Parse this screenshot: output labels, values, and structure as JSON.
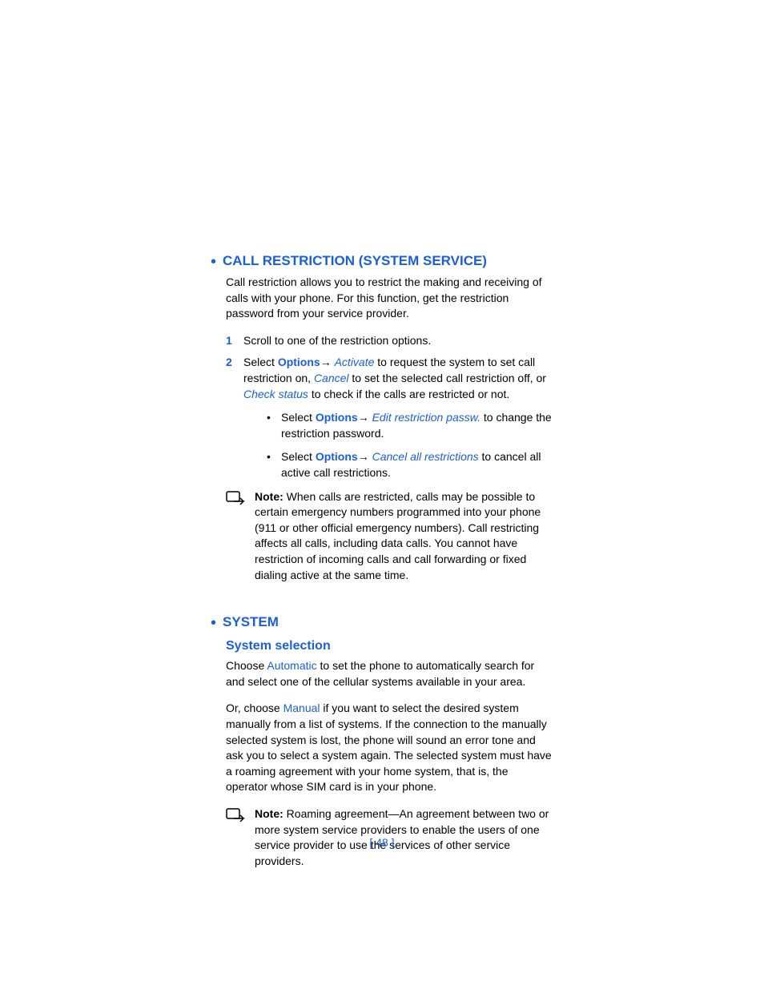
{
  "section1": {
    "title": "CALL RESTRICTION (SYSTEM SERVICE)",
    "intro": "Call restriction allows you to restrict the making and receiving of calls with your phone. For this function, get the restriction password from your service provider.",
    "step1_num": "1",
    "step1": "Scroll to one of the restriction options.",
    "step2_num": "2",
    "step2_pre": "Select ",
    "options": "Options",
    "arrow": "→ ",
    "activate": "Activate",
    "step2_mid1": " to request the system to set call restriction on, ",
    "cancel": "Cancel",
    "step2_mid2": " to set the selected call restriction off, or ",
    "check_status": "Check status",
    "step2_end": " to check if the calls are restricted or not.",
    "sub1_pre": "Select ",
    "sub1_action": "Edit restriction passw.",
    "sub1_end": " to change the restriction password.",
    "sub2_pre": "Select ",
    "sub2_action": "Cancel all restrictions",
    "sub2_end": " to cancel all active call restrictions.",
    "note_label": "Note:",
    "note_body": " When calls are restricted, calls may be possible to certain emergency numbers programmed into your phone (911 or other official emergency numbers). Call restricting affects all calls, including data calls. You cannot have restriction of incoming calls and call forwarding or fixed dialing active at the same time."
  },
  "section2": {
    "title": "SYSTEM",
    "subtitle": "System selection",
    "p1_pre": "Choose ",
    "automatic": "Automatic",
    "p1_end": " to set the phone to automatically search for and select one of the cellular systems available in your area.",
    "p2_pre": "Or, choose ",
    "manual": "Manual",
    "p2_end": " if you want to select the desired system manually from a list of systems. If the connection to the manually selected system is lost, the phone will sound an error tone and ask you to select a system again. The selected system must have a roaming agreement with your home system, that is, the operator whose SIM card is in your phone.",
    "note_label": "Note:",
    "note_body": " Roaming agreement—An agreement between two or more system service providers to enable the users of one service provider to use the services of other service providers."
  },
  "page_number": "[ 48 ]"
}
